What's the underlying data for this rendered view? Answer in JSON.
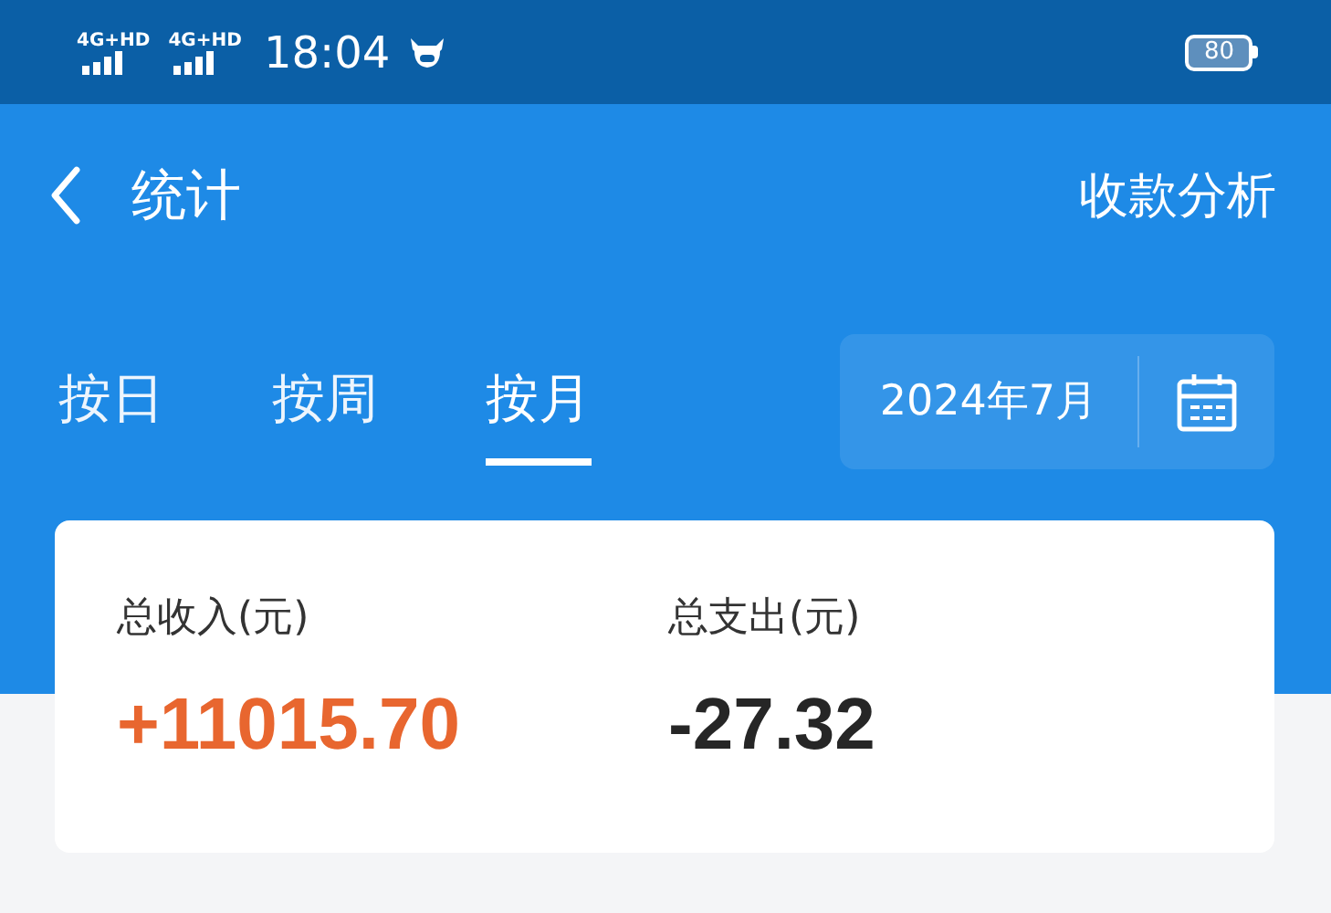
{
  "status_bar": {
    "signals": [
      {
        "label": "4G+HD"
      },
      {
        "label": "4G+HD"
      }
    ],
    "time": "18:04",
    "battery": "80"
  },
  "header": {
    "title": "统计",
    "action": "收款分析"
  },
  "tabs": [
    {
      "label": "按日",
      "selected": false
    },
    {
      "label": "按周",
      "selected": false
    },
    {
      "label": "按月",
      "selected": true
    }
  ],
  "date_picker": {
    "value": "2024年7月"
  },
  "summary": [
    {
      "label": "总收入(元)",
      "value": "+11015.70",
      "kind": "income"
    },
    {
      "label": "总支出(元)",
      "value": "-27.32",
      "kind": "expense"
    }
  ]
}
